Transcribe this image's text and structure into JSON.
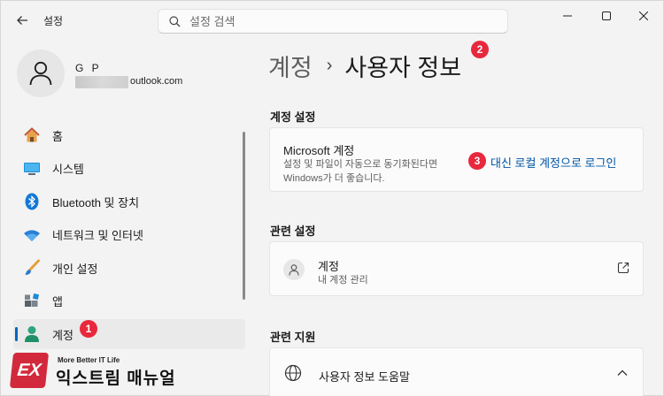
{
  "titlebar": {
    "app_title": "설정",
    "search_placeholder": "설정 검색"
  },
  "profile": {
    "name": "G P",
    "email_visible_suffix": "outlook.com"
  },
  "sidebar": {
    "items": [
      {
        "label": "홈",
        "icon": "home-icon"
      },
      {
        "label": "시스템",
        "icon": "system-icon"
      },
      {
        "label": "Bluetooth 및 장치",
        "icon": "bluetooth-icon"
      },
      {
        "label": "네트워크 및 인터넷",
        "icon": "wifi-icon"
      },
      {
        "label": "개인 설정",
        "icon": "brush-icon"
      },
      {
        "label": "앱",
        "icon": "apps-icon"
      },
      {
        "label": "계정",
        "icon": "account-icon",
        "active": true
      }
    ]
  },
  "breadcrumb": {
    "parent": "계정",
    "separator": "›",
    "current": "사용자 정보"
  },
  "sections": {
    "account_settings": "계정 설정",
    "related_settings": "관련 설정",
    "related_support": "관련 지원"
  },
  "ms_account_card": {
    "title": "Microsoft 계정",
    "description": "설정 및 파일이 자동으로 동기화된다면 Windows가 더 좋습니다.",
    "link": "대신 로컬 계정으로 로그인"
  },
  "accounts_card": {
    "title": "계정",
    "subtitle": "내 계정 관리"
  },
  "help_card": {
    "title": "사용자 정보 도움말"
  },
  "annotations": {
    "badge1": "1",
    "badge2": "2",
    "badge3": "3"
  },
  "watermark": {
    "logo": "EX",
    "tagline": "More Better IT Life",
    "name": "익스트림 매뉴얼"
  },
  "colors": {
    "accent": "#0067c0",
    "link": "#0055a6",
    "badge": "#e8283d",
    "background": "#f3f3f3",
    "card": "#fbfbfb"
  }
}
